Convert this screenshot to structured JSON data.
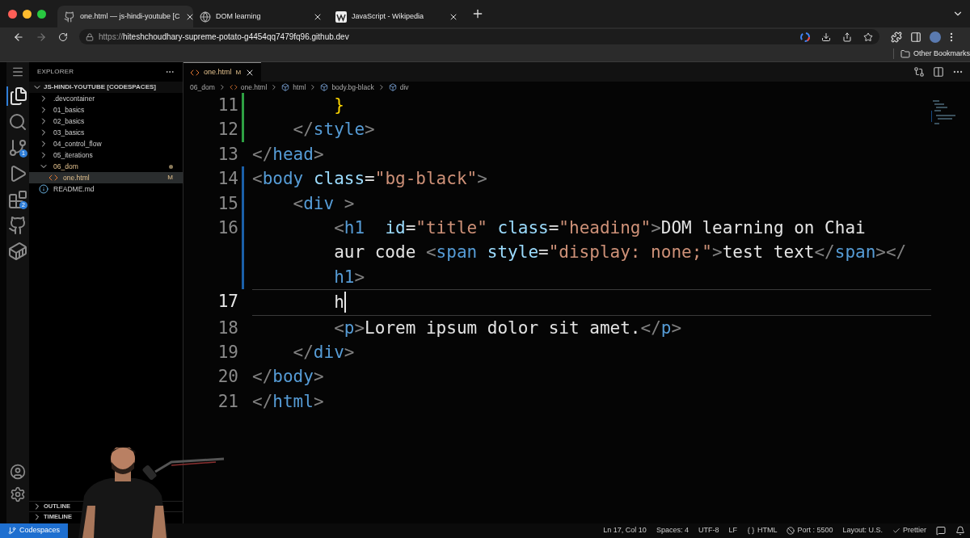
{
  "browser": {
    "tabs": [
      {
        "title": "one.html — js-hindi-youtube [C",
        "kind": "github",
        "selected": true
      },
      {
        "title": "DOM learning",
        "kind": "globe",
        "selected": false
      },
      {
        "title": "JavaScript - Wikipedia",
        "kind": "wikipedia",
        "selected": false
      }
    ],
    "url": {
      "scheme": "https://",
      "host": "hiteshchoudhary-supreme-potato-g4454qq7479fq96.github.dev"
    },
    "bookmarks": [
      "Other Bookmarks"
    ]
  },
  "activity_bar": [
    {
      "kind": "explorer",
      "selected": true
    },
    {
      "kind": "search",
      "selected": false
    },
    {
      "kind": "source-control",
      "selected": false,
      "badge": "1"
    },
    {
      "kind": "run",
      "selected": false
    },
    {
      "kind": "extensions",
      "selected": false,
      "badge": "2"
    },
    {
      "kind": "github",
      "selected": false
    },
    {
      "kind": "docker",
      "selected": false
    }
  ],
  "sidebar": {
    "title": "EXPLORER",
    "root": "JS-HINDI-YOUTUBE [CODESPACES]",
    "tree": [
      {
        "name": ".devcontainer",
        "kind": "folder",
        "expanded": false,
        "modified": false
      },
      {
        "name": "01_basics",
        "kind": "folder",
        "expanded": false,
        "modified": false
      },
      {
        "name": "02_basics",
        "kind": "folder",
        "expanded": false,
        "modified": false
      },
      {
        "name": "03_basics",
        "kind": "folder",
        "expanded": false,
        "modified": false
      },
      {
        "name": "04_control_flow",
        "kind": "folder",
        "expanded": false,
        "modified": false
      },
      {
        "name": "05_iterations",
        "kind": "folder",
        "expanded": false,
        "modified": false
      },
      {
        "name": "06_dom",
        "kind": "folder",
        "expanded": true,
        "modified": true,
        "children": [
          {
            "name": "one.html",
            "kind": "html",
            "badge": "M",
            "selected": true
          }
        ]
      },
      {
        "name": "README.md",
        "kind": "info",
        "selected": false
      }
    ],
    "sections": [
      "OUTLINE",
      "TIMELINE"
    ]
  },
  "editor": {
    "tab": {
      "label": "one.html",
      "badge": "M"
    },
    "breadcrumb": [
      {
        "text": "06_dom",
        "kind": "folder"
      },
      {
        "text": "one.html",
        "kind": "html"
      },
      {
        "text": "html",
        "kind": "element"
      },
      {
        "text": "body.bg-black",
        "kind": "element"
      },
      {
        "text": "div",
        "kind": "element"
      }
    ],
    "lines": [
      {
        "number": "11",
        "added": true,
        "modified": false,
        "current": false,
        "rows": [
          {
            "tokens": [
              {
                "t": "        }",
                "kind": "brace"
              }
            ]
          }
        ]
      },
      {
        "number": "12",
        "added": true,
        "modified": false,
        "current": false,
        "rows": [
          {
            "tokens": [
              {
                "t": "    </",
                "kind": "punct"
              },
              {
                "t": "style",
                "kind": "tag"
              },
              {
                "t": ">",
                "kind": "punct"
              }
            ]
          }
        ]
      },
      {
        "number": "13",
        "added": false,
        "modified": false,
        "current": false,
        "rows": [
          {
            "tokens": [
              {
                "t": "</",
                "kind": "punct"
              },
              {
                "t": "head",
                "kind": "tag"
              },
              {
                "t": ">",
                "kind": "punct"
              }
            ]
          }
        ]
      },
      {
        "number": "14",
        "added": false,
        "modified": true,
        "current": false,
        "rows": [
          {
            "tokens": [
              {
                "t": "<",
                "kind": "punct"
              },
              {
                "t": "body",
                "kind": "tag"
              },
              {
                "t": " class",
                "kind": "attr"
              },
              {
                "t": "=",
                "kind": "text"
              },
              {
                "t": "\"bg-black\"",
                "kind": "string"
              },
              {
                "t": ">",
                "kind": "punct"
              }
            ]
          }
        ]
      },
      {
        "number": "15",
        "added": false,
        "modified": true,
        "current": false,
        "rows": [
          {
            "tokens": [
              {
                "t": "    <",
                "kind": "punct"
              },
              {
                "t": "div",
                "kind": "tag"
              },
              {
                "t": " >",
                "kind": "punct"
              }
            ]
          }
        ]
      },
      {
        "number": "16",
        "added": false,
        "modified": true,
        "current": false,
        "rows": [
          {
            "tokens": [
              {
                "t": "        <",
                "kind": "punct"
              },
              {
                "t": "h1",
                "kind": "tag"
              },
              {
                "t": "  id",
                "kind": "attr"
              },
              {
                "t": "=",
                "kind": "text"
              },
              {
                "t": "\"title\"",
                "kind": "string"
              },
              {
                "t": " class",
                "kind": "attr"
              },
              {
                "t": "=",
                "kind": "text"
              },
              {
                "t": "\"heading\"",
                "kind": "string"
              },
              {
                "t": ">",
                "kind": "punct"
              },
              {
                "t": "DOM learning on Chai",
                "kind": "text"
              }
            ]
          },
          {
            "tokens": [
              {
                "t": "        aur code ",
                "kind": "text"
              },
              {
                "t": "<",
                "kind": "punct"
              },
              {
                "t": "span",
                "kind": "tag"
              },
              {
                "t": " style",
                "kind": "attr"
              },
              {
                "t": "=",
                "kind": "text"
              },
              {
                "t": "\"display: none;\"",
                "kind": "string"
              },
              {
                "t": ">",
                "kind": "punct"
              },
              {
                "t": "test text",
                "kind": "text"
              },
              {
                "t": "</",
                "kind": "punct"
              },
              {
                "t": "span",
                "kind": "tag"
              },
              {
                "t": "></",
                "kind": "punct"
              }
            ]
          },
          {
            "tokens": [
              {
                "t": "        h1",
                "kind": "tag"
              },
              {
                "t": ">",
                "kind": "punct"
              }
            ]
          }
        ]
      },
      {
        "number": "17",
        "added": false,
        "modified": false,
        "current": true,
        "rows": [
          {
            "tokens": [
              {
                "t": "        h",
                "kind": "text"
              }
            ]
          }
        ]
      },
      {
        "number": "18",
        "added": false,
        "modified": false,
        "current": false,
        "rows": [
          {
            "tokens": [
              {
                "t": "        <",
                "kind": "punct"
              },
              {
                "t": "p",
                "kind": "tag"
              },
              {
                "t": ">",
                "kind": "punct"
              },
              {
                "t": "Lorem ipsum dolor sit amet.",
                "kind": "text"
              },
              {
                "t": "</",
                "kind": "punct"
              },
              {
                "t": "p",
                "kind": "tag"
              },
              {
                "t": ">",
                "kind": "punct"
              }
            ]
          }
        ]
      },
      {
        "number": "19",
        "added": false,
        "modified": false,
        "current": false,
        "rows": [
          {
            "tokens": [
              {
                "t": "    </",
                "kind": "punct"
              },
              {
                "t": "div",
                "kind": "tag"
              },
              {
                "t": ">",
                "kind": "punct"
              }
            ]
          }
        ]
      },
      {
        "number": "20",
        "added": false,
        "modified": false,
        "current": false,
        "rows": [
          {
            "tokens": [
              {
                "t": "</",
                "kind": "punct"
              },
              {
                "t": "body",
                "kind": "tag"
              },
              {
                "t": ">",
                "kind": "punct"
              }
            ]
          }
        ]
      },
      {
        "number": "21",
        "added": false,
        "modified": false,
        "current": false,
        "rows": [
          {
            "tokens": [
              {
                "t": "</",
                "kind": "punct"
              },
              {
                "t": "html",
                "kind": "tag"
              },
              {
                "t": ">",
                "kind": "punct"
              }
            ]
          }
        ]
      }
    ]
  },
  "status_bar": {
    "remote": "Codespaces",
    "items": [
      {
        "text": "Ln 17, Col 10",
        "kind": "plain"
      },
      {
        "text": "Spaces: 4",
        "kind": "plain"
      },
      {
        "text": "UTF-8",
        "kind": "plain"
      },
      {
        "text": "LF",
        "kind": "plain"
      },
      {
        "text": "HTML",
        "kind": "language"
      },
      {
        "text": "Port : 5500",
        "kind": "port"
      },
      {
        "text": "Layout: U.S.",
        "kind": "plain"
      },
      {
        "text": "Prettier",
        "kind": "prettier"
      }
    ]
  }
}
